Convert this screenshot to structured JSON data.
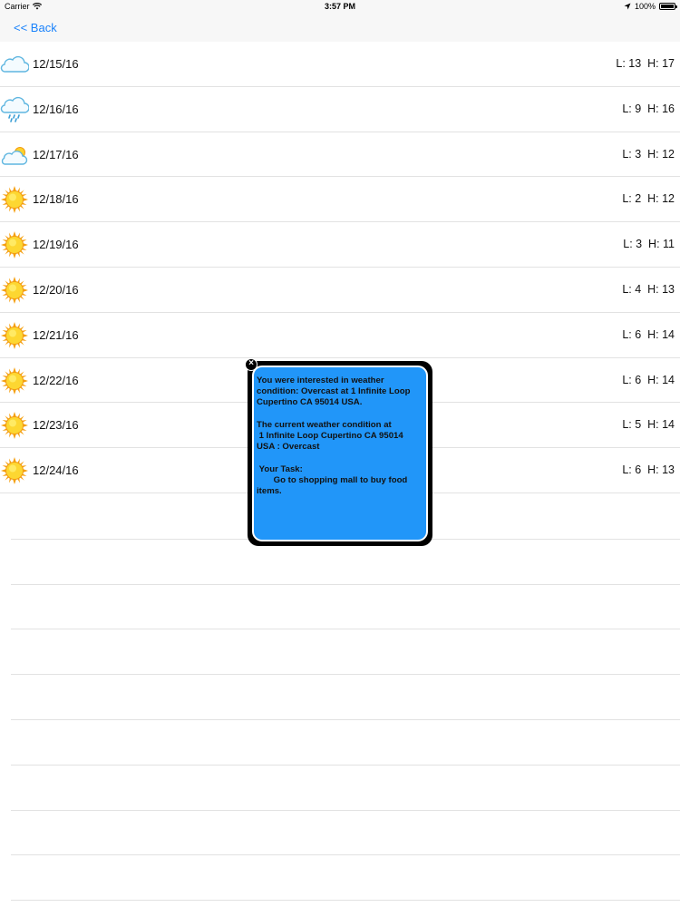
{
  "status_bar": {
    "carrier": "Carrier",
    "time": "3:57 PM",
    "battery": "100%",
    "battery_level": 1.0
  },
  "nav": {
    "back_label": "<< Back"
  },
  "forecast": [
    {
      "date": "12/15/16",
      "temps": "L: 13  H: 17",
      "icon": "cloud-icon"
    },
    {
      "date": "12/16/16",
      "temps": "L: 9  H: 16",
      "icon": "rain-cloud-icon"
    },
    {
      "date": "12/17/16",
      "temps": "L: 3  H: 12",
      "icon": "partly-cloudy-icon"
    },
    {
      "date": "12/18/16",
      "temps": "L: 2  H: 12",
      "icon": "sun-icon"
    },
    {
      "date": "12/19/16",
      "temps": "L: 3  H: 11",
      "icon": "sun-icon"
    },
    {
      "date": "12/20/16",
      "temps": "L: 4  H: 13",
      "icon": "sun-icon"
    },
    {
      "date": "12/21/16",
      "temps": "L: 6  H: 14",
      "icon": "sun-icon"
    },
    {
      "date": "12/22/16",
      "temps": "L: 6  H: 14",
      "icon": "sun-icon"
    },
    {
      "date": "12/23/16",
      "temps": "L: 5  H: 14",
      "icon": "sun-icon"
    },
    {
      "date": "12/24/16",
      "temps": "L: 6  H: 13",
      "icon": "sun-icon"
    }
  ],
  "popup": {
    "message": "You were interested in weather condition: Overcast at 1 Infinite Loop Cupertino CA 95014 USA.\n\nThe current weather condition at\n 1 Infinite Loop Cupertino CA 95014 USA : Overcast\n\n Your Task:\n       Go to shopping mall to buy food items.",
    "close_icon": "close-icon"
  },
  "colors": {
    "accent": "#1a82fb",
    "popup_background": "#2196f9",
    "popup_frame": "#000000",
    "separator": "#e2e2e2"
  }
}
